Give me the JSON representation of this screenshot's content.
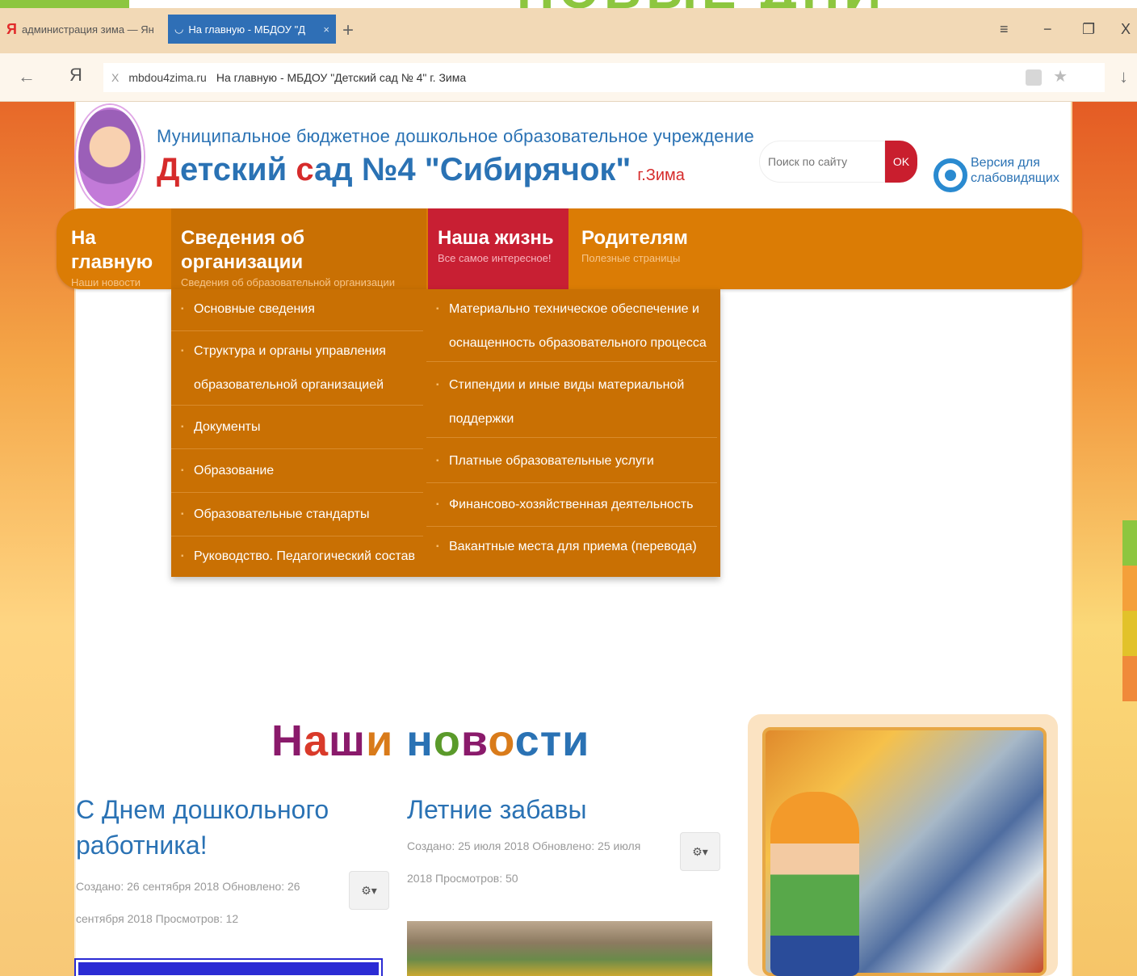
{
  "slide": {
    "title_fragment": "НОВЫЕ ДНИ"
  },
  "browser": {
    "tabs": [
      {
        "label": "администрация зима — Ян",
        "icon": "yandex-icon"
      },
      {
        "label": "На главную - МБДОУ \"Д",
        "icon": "loading-icon",
        "active": true
      }
    ],
    "new_tab": "+",
    "controls": {
      "menu": "≡",
      "minimize": "−",
      "restore": "❐",
      "close": "X"
    },
    "address": {
      "domain": "mbdou4zima.ru",
      "title": "На главную - МБДОУ \"Детский сад № 4\" г. Зима",
      "clear": "X"
    },
    "back": "←",
    "ya": "Я",
    "download": "↓"
  },
  "header": {
    "subtitle": "Муниципальное бюджетное дошкольное образовательное учреждение",
    "title_d": "Д",
    "title_mid1": "етский ",
    "title_s": "с",
    "title_mid2": "ад №4 \"Сибирячок\"",
    "city": "г.Зима",
    "search_placeholder": "Поиск по сайту",
    "search_button": "OK",
    "vision_line1": "Версия для",
    "vision_line2": "слабовидящих"
  },
  "nav": [
    {
      "title": "На главную",
      "sub": "Наши новости"
    },
    {
      "title": "Сведения об организации",
      "sub": "Сведения об образовательной организации"
    },
    {
      "title": "Наша жизнь",
      "sub": "Все самое интересное!"
    },
    {
      "title": "Родителям",
      "sub": "Полезные страницы"
    }
  ],
  "dropdown_left": [
    "Основные сведения",
    "Структура и органы управления образовательной организацией",
    "Документы",
    "Образование",
    "Образовательные стандарты",
    "Руководство. Педагогический состав"
  ],
  "dropdown_right": [
    "Материально техническое обеспечение и оснащенность образовательного процесса",
    "Стипендии и иные виды материальной поддержки",
    "Платные образовательные услуги",
    "Финансово-хозяйственная деятельность",
    "Вакантные места для приема (перевода)"
  ],
  "news": {
    "heading": [
      "Н",
      "а",
      "ш",
      "и",
      " н",
      "о",
      "в",
      "о",
      "сти"
    ],
    "articles": [
      {
        "title": "С Днем дошкольного работника!",
        "meta1": "Создано: 26 сентября 2018   Обновлено: 26",
        "meta2": "сентября 2018   Просмотров: 12"
      },
      {
        "title": "Летние забавы",
        "meta1": "Создано: 25 июля 2018   Обновлено: 25 июля",
        "meta2": "2018   Просмотров: 50"
      }
    ],
    "gear": "⚙▾"
  }
}
